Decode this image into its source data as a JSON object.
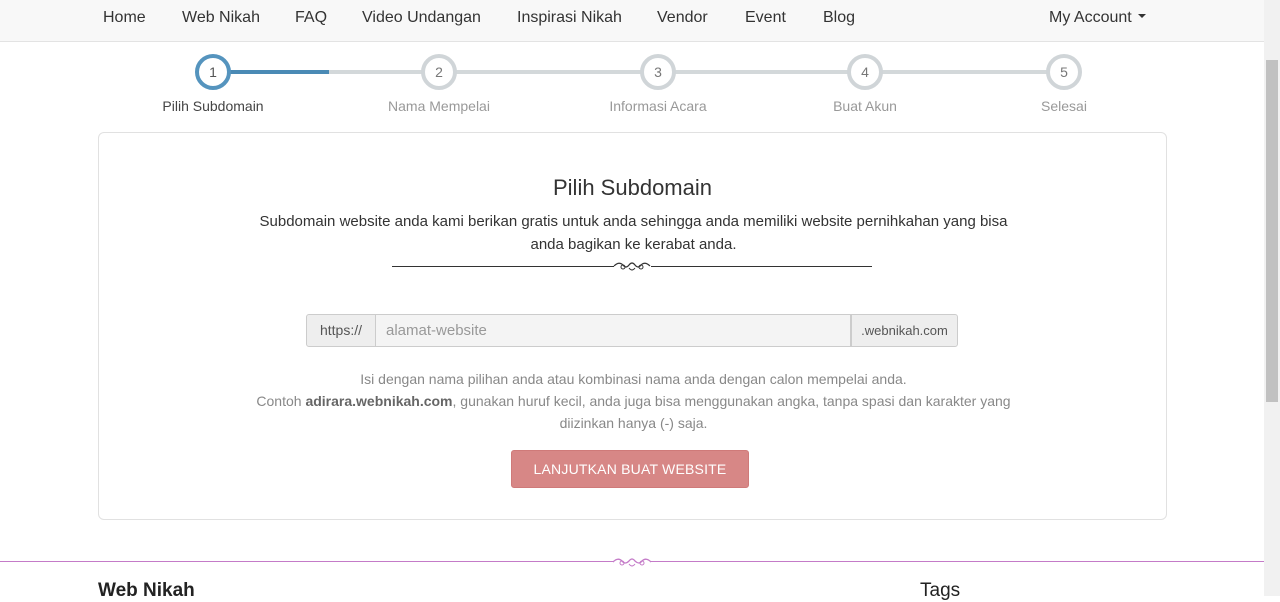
{
  "nav": {
    "items": [
      "Home",
      "Web Nikah",
      "FAQ",
      "Video Undangan",
      "Inspirasi Nikah",
      "Vendor",
      "Event",
      "Blog"
    ],
    "account_label": "My Account"
  },
  "steps": [
    {
      "number": "1",
      "label": "Pilih Subdomain",
      "active": true
    },
    {
      "number": "2",
      "label": "Nama Mempelai",
      "active": false
    },
    {
      "number": "3",
      "label": "Informasi Acara",
      "active": false
    },
    {
      "number": "4",
      "label": "Buat Akun",
      "active": false
    },
    {
      "number": "5",
      "label": "Selesai",
      "active": false
    }
  ],
  "card": {
    "title": "Pilih Subdomain",
    "description": "Subdomain website anda kami berikan gratis untuk anda sehingga anda memiliki website pernihkahan yang bisa anda bagikan ke kerabat anda.",
    "prefix": "https://",
    "input_placeholder": "alamat-website",
    "input_value": "",
    "suffix": ".webnikah.com",
    "help_line1": "Isi dengan nama pilihan anda atau kombinasi nama anda dengan calon mempelai anda.",
    "help_line2_prefix": "Contoh ",
    "help_example": "adirara.webnikah.com",
    "help_line2_suffix": ", gunakan huruf kecil, anda juga bisa menggunakan angka, tanpa spasi dan karakter yang diizinkan hanya (-) saja.",
    "button_label": "LANJUTKAN BUAT WEBSITE"
  },
  "footer": {
    "heading_left": "Web Nikah",
    "heading_right": "Tags"
  },
  "colors": {
    "step_active": "#5594be",
    "button": "#d78786",
    "footer_ornament": "#c47bc8"
  }
}
